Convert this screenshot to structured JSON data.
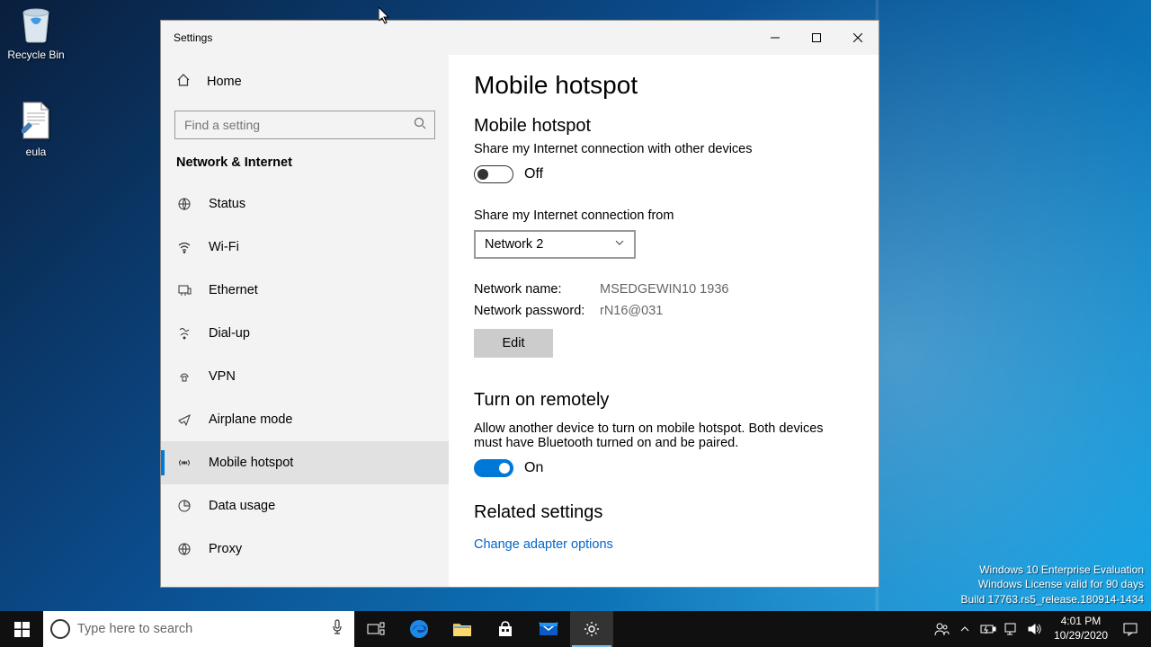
{
  "desktop": {
    "recycle_label": "Recycle Bin",
    "eula_label": "eula"
  },
  "watermark": {
    "line1": "Windows 10 Enterprise Evaluation",
    "line2": "Windows License valid for 90 days",
    "line3": "Build 17763.rs5_release.180914-1434"
  },
  "window": {
    "title": "Settings",
    "home": "Home",
    "search_placeholder": "Find a setting",
    "category": "Network & Internet",
    "nav": [
      {
        "label": "Status"
      },
      {
        "label": "Wi-Fi"
      },
      {
        "label": "Ethernet"
      },
      {
        "label": "Dial-up"
      },
      {
        "label": "VPN"
      },
      {
        "label": "Airplane mode"
      },
      {
        "label": "Mobile hotspot"
      },
      {
        "label": "Data usage"
      },
      {
        "label": "Proxy"
      }
    ]
  },
  "page": {
    "title": "Mobile hotspot",
    "section1_title": "Mobile hotspot",
    "section1_desc": "Share my Internet connection with other devices",
    "toggle1_state": "Off",
    "share_from_label": "Share my Internet connection from",
    "share_from_value": "Network 2",
    "net_name_label": "Network name:",
    "net_name_value": "MSEDGEWIN10 1936",
    "net_pass_label": "Network password:",
    "net_pass_value": "rN16@031",
    "edit": "Edit",
    "section2_title": "Turn on remotely",
    "section2_desc": "Allow another device to turn on mobile hotspot. Both devices must have Bluetooth turned on and be paired.",
    "toggle2_state": "On",
    "related_title": "Related settings",
    "related_link": "Change adapter options"
  },
  "taskbar": {
    "search_placeholder": "Type here to search",
    "time": "4:01 PM",
    "date": "10/29/2020"
  }
}
